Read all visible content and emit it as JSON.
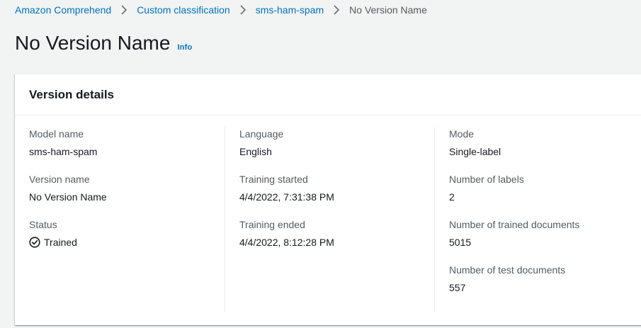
{
  "breadcrumb": {
    "items": [
      "Amazon Comprehend",
      "Custom classification",
      "sms-ham-spam"
    ],
    "current": "No Version Name"
  },
  "header": {
    "title": "No Version Name",
    "info": "Info"
  },
  "panel": {
    "title": "Version details",
    "col1": {
      "model_name_label": "Model name",
      "model_name": "sms-ham-spam",
      "version_name_label": "Version name",
      "version_name": "No Version Name",
      "status_label": "Status",
      "status": "Trained",
      "status_icon": "check-circle-icon"
    },
    "col2": {
      "language_label": "Language",
      "language": "English",
      "training_started_label": "Training started",
      "training_started": "4/4/2022, 7:31:38 PM",
      "training_ended_label": "Training ended",
      "training_ended": "4/4/2022, 8:12:28 PM"
    },
    "col3": {
      "mode_label": "Mode",
      "mode": "Single-label",
      "num_labels_label": "Number of labels",
      "num_labels": "2",
      "num_trained_label": "Number of trained documents",
      "num_trained": "5015",
      "num_test_label": "Number of test documents",
      "num_test": "557"
    }
  },
  "colors": {
    "link": "#0073bb",
    "text": "#16191f",
    "label": "#545b64",
    "background": "#f2f3f3"
  }
}
